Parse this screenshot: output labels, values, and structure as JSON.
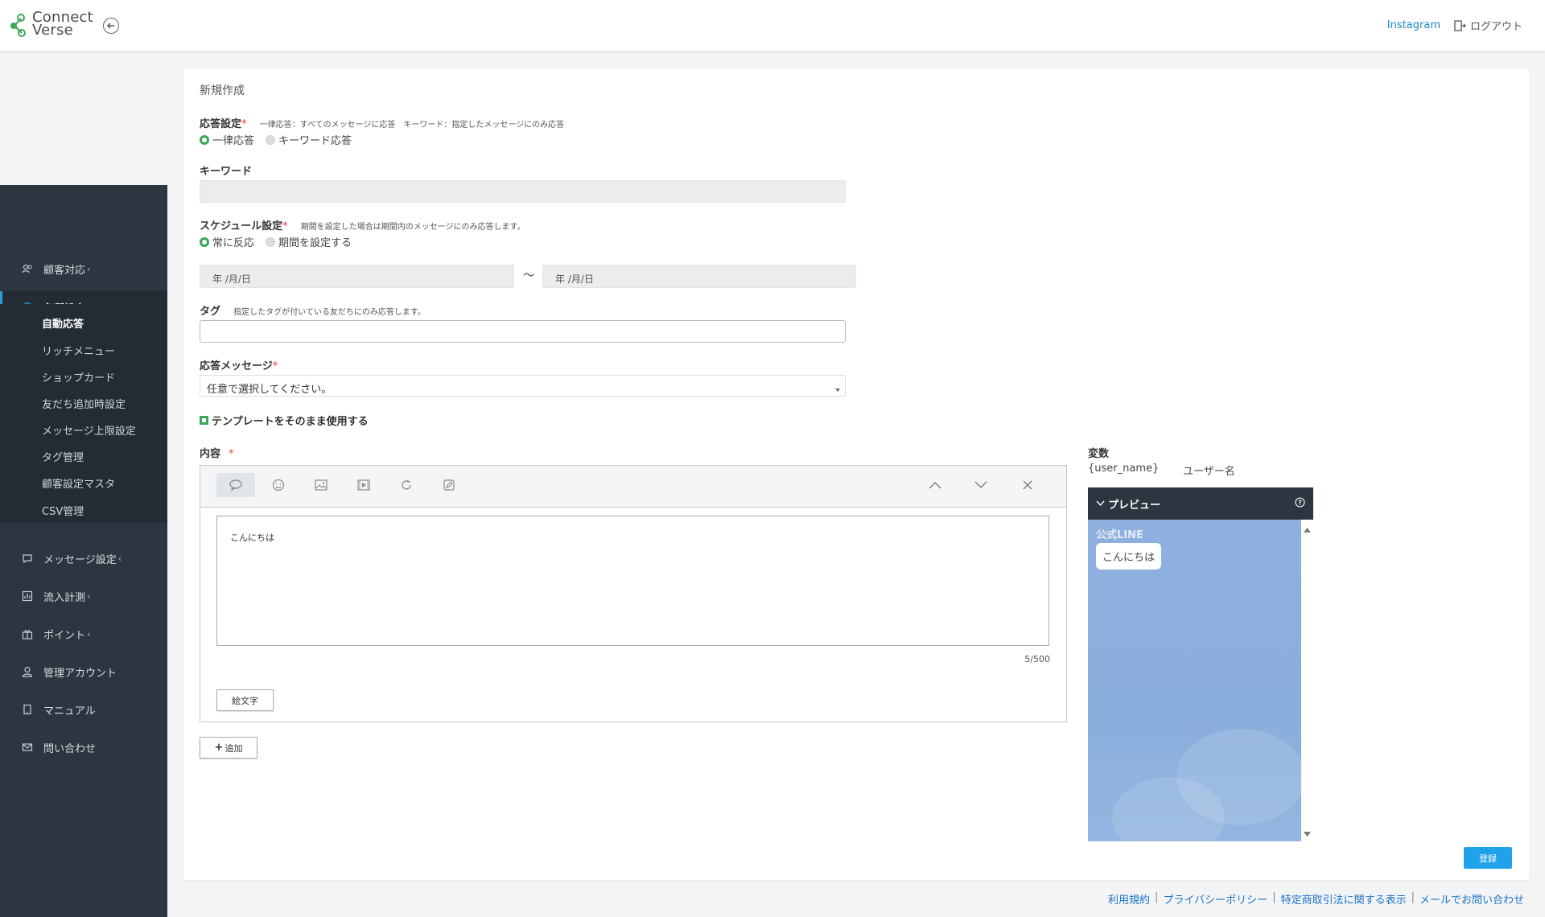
{
  "header": {
    "logo_line1": "Connect",
    "logo_line2": "Verse",
    "instagram_link": "Instagram",
    "logout": "ログアウト"
  },
  "sidebar": {
    "items": [
      {
        "label": "顧客対応",
        "chevron": "‹",
        "icon": "users-icon"
      },
      {
        "label": "各種設定",
        "chevron": "⌄",
        "icon": "gear-icon"
      },
      {
        "label": "メッセージ設定",
        "chevron": "‹",
        "icon": "chat-icon"
      },
      {
        "label": "流入計測",
        "chevron": "‹",
        "icon": "chart-icon"
      },
      {
        "label": "ポイント",
        "chevron": "‹",
        "icon": "gift-icon"
      },
      {
        "label": "管理アカウント",
        "chevron": "",
        "icon": "user-icon"
      },
      {
        "label": "マニュアル",
        "chevron": "",
        "icon": "book-icon"
      },
      {
        "label": "問い合わせ",
        "chevron": "",
        "icon": "mail-icon"
      }
    ],
    "sub_items": [
      "自動応答",
      "リッチメニュー",
      "ショップカード",
      "友だち追加時設定",
      "メッセージ上限設定",
      "タグ管理",
      "顧客設定マスタ",
      "CSV管理"
    ]
  },
  "form": {
    "title": "新規作成",
    "response_label": "応答設定",
    "response_hint": "一律応答：すべてのメッセージに応答　キーワード：指定したメッセージにのみ応答",
    "response_opt1": "一律応答",
    "response_opt2": "キーワード応答",
    "keyword_label": "キーワード",
    "schedule_label": "スケジュール設定",
    "schedule_hint": "期間を設定した場合は期間内のメッセージにのみ応答します。",
    "schedule_opt1": "常に反応",
    "schedule_opt2": "期間を設定する",
    "date_start_placeholder": "年 /月/日",
    "date_end_placeholder": "年 /月/日",
    "tilde": "〜",
    "tag_label": "タグ",
    "tag_hint": "指定したタグが付いている友だちにのみ応答します。",
    "message_label": "応答メッセージ",
    "message_select": "任意で選択してください。",
    "template_check": "テンプレートをそのまま使用する",
    "content_label": "内容",
    "content_text": "こんにちは",
    "counter": "5/500",
    "emoji_button": "絵文字",
    "add_button": "追加",
    "submit_button": "登録",
    "required_mark": "*"
  },
  "variables": {
    "title": "変数",
    "key": "{user_name}",
    "value": "ユーザー名"
  },
  "preview": {
    "title": "プレビュー",
    "account": "公式LINE",
    "bubble": "こんにちは"
  },
  "footer": {
    "links": [
      "利用規約",
      "プライバシーポリシー",
      "特定商取引法に関する表示",
      "メールでお問い合わせ"
    ]
  },
  "colors": {
    "accent": "#1fa2e8",
    "sidebar_bg": "#2c3540",
    "radio_green": "#3aa757",
    "required_red": "#e53935"
  }
}
